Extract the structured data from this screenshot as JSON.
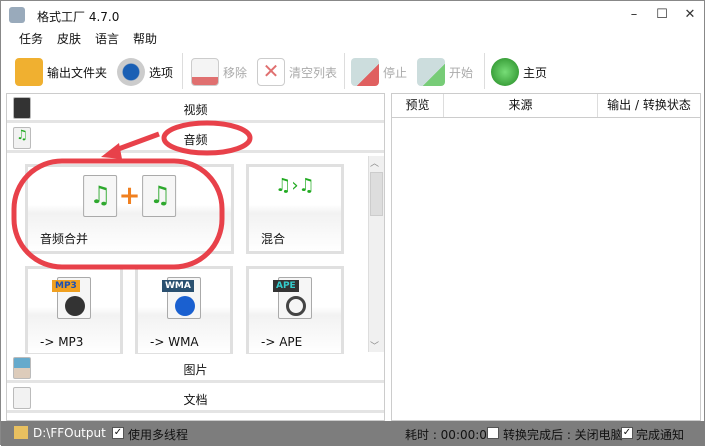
{
  "title": "格式工厂 4.7.0",
  "menu": [
    "任务",
    "皮肤",
    "语言",
    "帮助"
  ],
  "toolbar": {
    "output_folder": "输出文件夹",
    "options": "选项",
    "remove": "移除",
    "clear_list": "清空列表",
    "stop": "停止",
    "start": "开始",
    "home": "主页"
  },
  "categories": {
    "video": "视频",
    "audio": "音频",
    "image": "图片",
    "document": "文档"
  },
  "tiles": [
    "音频合并",
    "混合",
    "-> MP3",
    "-> WMA",
    "-> APE"
  ],
  "badges": {
    "mp3": "MP3",
    "wma": "WMA",
    "ape": "APE"
  },
  "table_headers": [
    "预览",
    "来源",
    "输出 / 转换状态"
  ],
  "status": {
    "path": "D:\\FFOutput",
    "multithread": "使用多线程",
    "elapsed": "耗时 : 00:00:00",
    "after": "转换完成后 : 关闭电脑",
    "notify": "完成通知",
    "multithread_checked": true,
    "after_checked": false,
    "notify_checked": true
  },
  "colors": {
    "annotation": "#e8414a",
    "status_bg": "#7d7d7d"
  }
}
